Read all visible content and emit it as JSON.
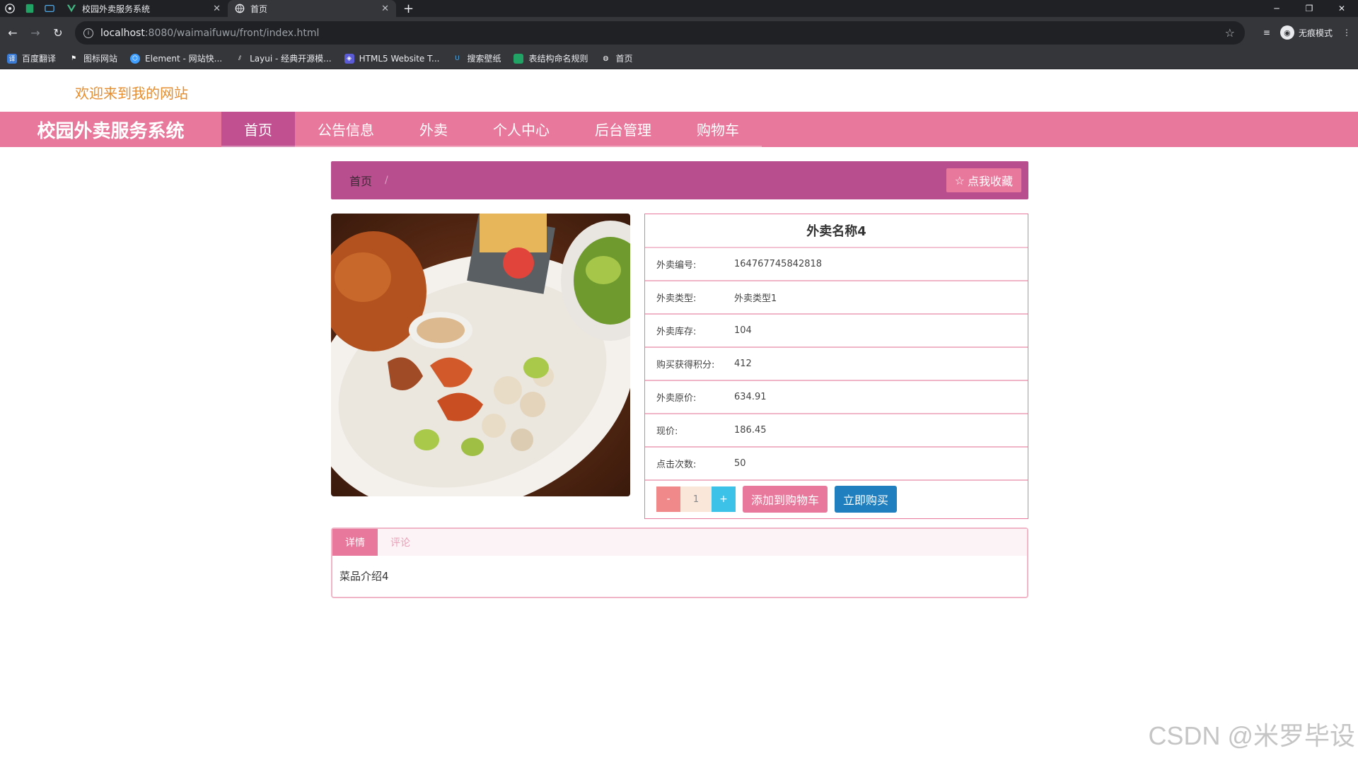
{
  "browser": {
    "tabs": [
      {
        "title": "校园外卖服务系统",
        "active": false
      },
      {
        "title": "首页",
        "active": true
      }
    ],
    "address": {
      "host": "localhost",
      "path": ":8080/waimaifuwu/front/index.html"
    },
    "profile_label": "无痕模式",
    "bookmarks": [
      "百度翻译",
      "图标网站",
      "Element - 网站快...",
      "Layui - 经典开源模...",
      "HTML5 Website T...",
      "搜索壁纸",
      "表结构命名规则",
      "首页"
    ]
  },
  "site": {
    "welcome": "欢迎来到我的网站",
    "brand": "校园外卖服务系统",
    "nav": [
      "首页",
      "公告信息",
      "外卖",
      "个人中心",
      "后台管理",
      "购物车"
    ],
    "active_nav": "首页"
  },
  "breadcrumb": {
    "home": "首页",
    "sep": "/",
    "fav_button": "点我收藏"
  },
  "product": {
    "name": "外卖名称4",
    "rows": [
      {
        "label": "外卖编号:",
        "value": "164767745842818"
      },
      {
        "label": "外卖类型:",
        "value": "外卖类型1"
      },
      {
        "label": "外卖库存:",
        "value": "104"
      },
      {
        "label": "购买获得积分:",
        "value": "412"
      },
      {
        "label": "外卖原价:",
        "value": "634.91"
      },
      {
        "label": "现价:",
        "value": "186.45"
      },
      {
        "label": "点击次数:",
        "value": "50"
      }
    ],
    "quantity": "1",
    "minus": "-",
    "plus": "+",
    "add_to_cart": "添加到购物车",
    "buy_now": "立即购买"
  },
  "tabs": {
    "items": [
      "详情",
      "评论"
    ],
    "active": "详情",
    "content": "菜品介绍4"
  },
  "watermark": "CSDN @米罗毕设",
  "colors": {
    "accent": "#e8799c",
    "nav_active": "#c0508f",
    "breadcrumb": "#b94e8f",
    "welcome": "#e58d2f",
    "buy": "#1f7fbf"
  }
}
